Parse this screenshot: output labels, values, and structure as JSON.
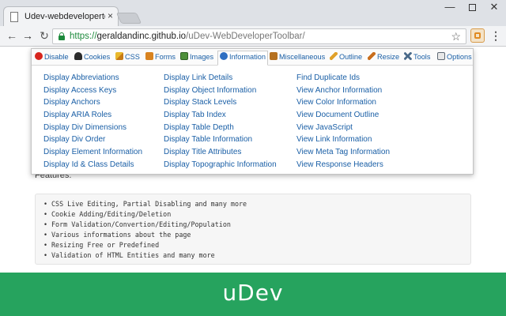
{
  "browser": {
    "tab_title": "Udev-webdevelopertoolb",
    "tab_close": "×",
    "window_controls": {
      "minimize": "—",
      "close": "✕"
    },
    "nav": {
      "back": "←",
      "forward": "→",
      "reload": "↻"
    },
    "url": {
      "scheme": "https://",
      "host": "geraldandinc.github.io",
      "path": "/uDev-WebDeveloperToolbar/"
    },
    "star": "☆",
    "menu": "⋮"
  },
  "popup": {
    "tabs": [
      {
        "label": "Disable",
        "icon": "disable-icon"
      },
      {
        "label": "Cookies",
        "icon": "cookies-icon"
      },
      {
        "label": "CSS",
        "icon": "css-icon"
      },
      {
        "label": "Forms",
        "icon": "forms-icon"
      },
      {
        "label": "Images",
        "icon": "images-icon"
      },
      {
        "label": "Information",
        "icon": "information-icon",
        "active": true
      },
      {
        "label": "Miscellaneous",
        "icon": "miscellaneous-icon"
      },
      {
        "label": "Outline",
        "icon": "outline-icon"
      },
      {
        "label": "Resize",
        "icon": "resize-icon"
      },
      {
        "label": "Tools",
        "icon": "tools-icon"
      },
      {
        "label": "Options",
        "icon": "options-icon"
      }
    ],
    "columns": [
      [
        "Display Abbreviations",
        "Display Access Keys",
        "Display Anchors",
        "Display ARIA Roles",
        "Display Div Dimensions",
        "Display Div Order",
        "Display Element Information",
        "Display Id & Class Details"
      ],
      [
        "Display Link Details",
        "Display Object Information",
        "Display Stack Levels",
        "Display Tab Index",
        "Display Table Depth",
        "Display Table Information",
        "Display Title Attributes",
        "Display Topographic Information"
      ],
      [
        "Find Duplicate Ids",
        "View Anchor Information",
        "View Color Information",
        "View Document Outline",
        "View JavaScript",
        "View Link Information",
        "View Meta Tag Information",
        "View Response Headers"
      ]
    ]
  },
  "page": {
    "features_label": "Features:",
    "features": [
      "CSS Live Editing, Partial Disabling and many more",
      "Cookie Adding/Editing/Deletion",
      "Form Validation/Convertion/Editing/Population",
      "Various informations about the page",
      "Resizing Free or Predefined",
      "Validation of HTML Entities and many more"
    ],
    "bullet": "•"
  },
  "banner": {
    "title": "uDev",
    "color": "#26a35e"
  }
}
